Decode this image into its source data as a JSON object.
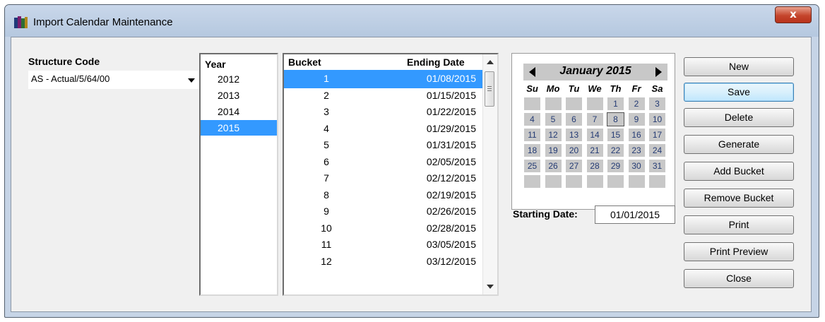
{
  "window": {
    "title": "Import Calendar Maintenance",
    "close_glyph": "x"
  },
  "structure": {
    "label": "Structure Code",
    "selected": "AS - Actual/5/64/00"
  },
  "years": {
    "header": "Year",
    "items": [
      {
        "label": "2012",
        "selected": false
      },
      {
        "label": "2013",
        "selected": false
      },
      {
        "label": "2014",
        "selected": false
      },
      {
        "label": "2015",
        "selected": true
      }
    ]
  },
  "buckets": {
    "col_bucket": "Bucket",
    "col_ending": "Ending Date",
    "rows": [
      {
        "bucket": "1",
        "ending": "01/08/2015",
        "selected": true
      },
      {
        "bucket": "2",
        "ending": "01/15/2015",
        "selected": false
      },
      {
        "bucket": "3",
        "ending": "01/22/2015",
        "selected": false
      },
      {
        "bucket": "4",
        "ending": "01/29/2015",
        "selected": false
      },
      {
        "bucket": "5",
        "ending": "01/31/2015",
        "selected": false
      },
      {
        "bucket": "6",
        "ending": "02/05/2015",
        "selected": false
      },
      {
        "bucket": "7",
        "ending": "02/12/2015",
        "selected": false
      },
      {
        "bucket": "8",
        "ending": "02/19/2015",
        "selected": false
      },
      {
        "bucket": "9",
        "ending": "02/26/2015",
        "selected": false
      },
      {
        "bucket": "10",
        "ending": "02/28/2015",
        "selected": false
      },
      {
        "bucket": "11",
        "ending": "03/05/2015",
        "selected": false
      },
      {
        "bucket": "12",
        "ending": "03/12/2015",
        "selected": false
      }
    ]
  },
  "calendar": {
    "month_label": "January 2015",
    "weekdays": [
      "Su",
      "Mo",
      "Tu",
      "We",
      "Th",
      "Fr",
      "Sa"
    ],
    "first_weekday": 4,
    "days_in_month": 31,
    "highlight_day": 8,
    "rows": 6
  },
  "starting_date": {
    "label": "Starting Date:",
    "value": "01/01/2015"
  },
  "buttons": {
    "new": "New",
    "save": "Save",
    "delete": "Delete",
    "generate": "Generate",
    "add_bucket": "Add Bucket",
    "remove_bucket": "Remove Bucket",
    "print": "Print",
    "print_preview": "Print Preview",
    "close": "Close"
  },
  "colors": {
    "selection": "#3399ff",
    "window_frame": "#c6d4e6",
    "close_red": "#c5452c"
  }
}
